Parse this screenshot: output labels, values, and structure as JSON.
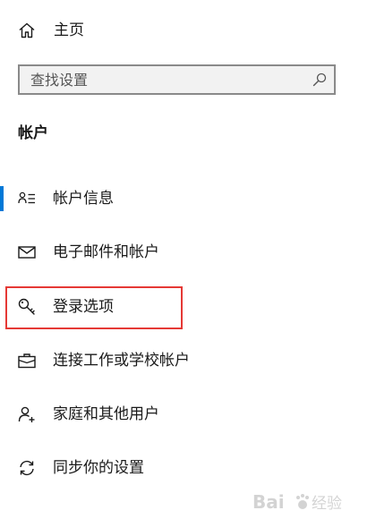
{
  "home": {
    "label": "主页",
    "icon": "home-icon"
  },
  "search": {
    "placeholder": "查找设置",
    "icon": "search-icon"
  },
  "section": {
    "title": "帐户"
  },
  "nav": {
    "items": [
      {
        "label": "帐户信息",
        "icon": "person-info-icon",
        "active": true
      },
      {
        "label": "电子邮件和帐户",
        "icon": "mail-icon",
        "active": false
      },
      {
        "label": "登录选项",
        "icon": "key-icon",
        "active": false,
        "highlighted": true
      },
      {
        "label": "连接工作或学校帐户",
        "icon": "briefcase-icon",
        "active": false
      },
      {
        "label": "家庭和其他用户",
        "icon": "add-person-icon",
        "active": false
      },
      {
        "label": "同步你的设置",
        "icon": "sync-icon",
        "active": false
      }
    ]
  },
  "watermark": {
    "brand": "Bai",
    "suffix": "经验"
  },
  "colors": {
    "accent": "#0078d7",
    "highlight": "#e53935",
    "search_border": "#8a8a8a",
    "search_bg": "#f2f2f2"
  }
}
